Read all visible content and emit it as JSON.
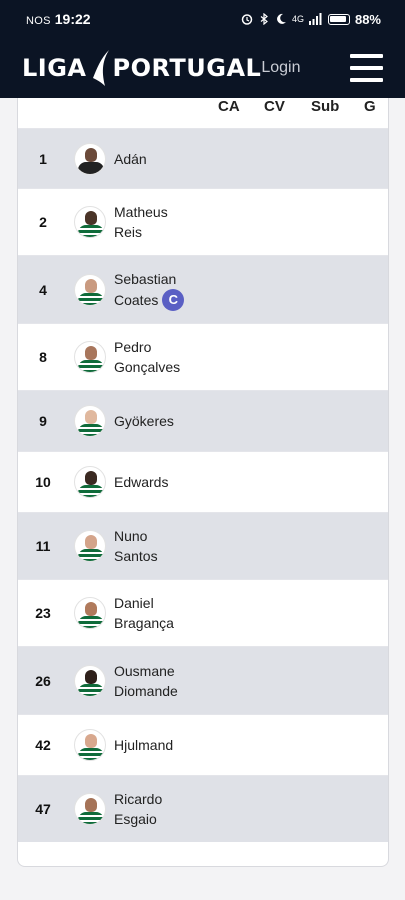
{
  "status_bar": {
    "carrier": "NOS",
    "time": "19:22",
    "network": "4G",
    "battery": "88%"
  },
  "header": {
    "logo_left": "LIGA",
    "logo_right": "PORTUGAL",
    "login": "Login"
  },
  "table": {
    "columns": [
      "CA",
      "CV",
      "Sub",
      "G"
    ],
    "players": [
      {
        "number": "1",
        "first": "Adán",
        "last": "",
        "captain": false,
        "shaded": true,
        "skin": "#6b4a3a",
        "kit": "dark"
      },
      {
        "number": "2",
        "first": "Matheus",
        "last": "Reis",
        "captain": false,
        "shaded": false,
        "skin": "#4a3428",
        "kit": "green"
      },
      {
        "number": "4",
        "first": "Sebastian",
        "last": "Coates",
        "captain": true,
        "captain_label": "C",
        "shaded": true,
        "skin": "#c99a80",
        "kit": "green"
      },
      {
        "number": "8",
        "first": "Pedro",
        "last": "Gonçalves",
        "captain": false,
        "shaded": false,
        "skin": "#a8765c",
        "kit": "green"
      },
      {
        "number": "9",
        "first": "Gyökeres",
        "last": "",
        "captain": false,
        "shaded": true,
        "skin": "#e0b89e",
        "kit": "green"
      },
      {
        "number": "10",
        "first": "Edwards",
        "last": "",
        "captain": false,
        "shaded": false,
        "skin": "#3b2a22",
        "kit": "green"
      },
      {
        "number": "11",
        "first": "Nuno",
        "last": "Santos",
        "captain": false,
        "shaded": true,
        "skin": "#d4a48a",
        "kit": "green"
      },
      {
        "number": "23",
        "first": "Daniel",
        "last": "Bragança",
        "captain": false,
        "shaded": false,
        "skin": "#b07a5c",
        "kit": "green"
      },
      {
        "number": "26",
        "first": "Ousmane",
        "last": "Diomande",
        "captain": false,
        "shaded": true,
        "skin": "#2f211b",
        "kit": "green"
      },
      {
        "number": "42",
        "first": "Hjulmand",
        "last": "",
        "captain": false,
        "shaded": false,
        "skin": "#d8a88e",
        "kit": "green"
      },
      {
        "number": "47",
        "first": "Ricardo",
        "last": "Esgaio",
        "captain": false,
        "shaded": true,
        "skin": "#a57358",
        "kit": "green"
      }
    ]
  },
  "colors": {
    "header_bg": "#0b1424",
    "row_shaded": "#dfe1e7",
    "captain_badge": "#5a5fc4",
    "kit_green": "#0f6b3a"
  }
}
